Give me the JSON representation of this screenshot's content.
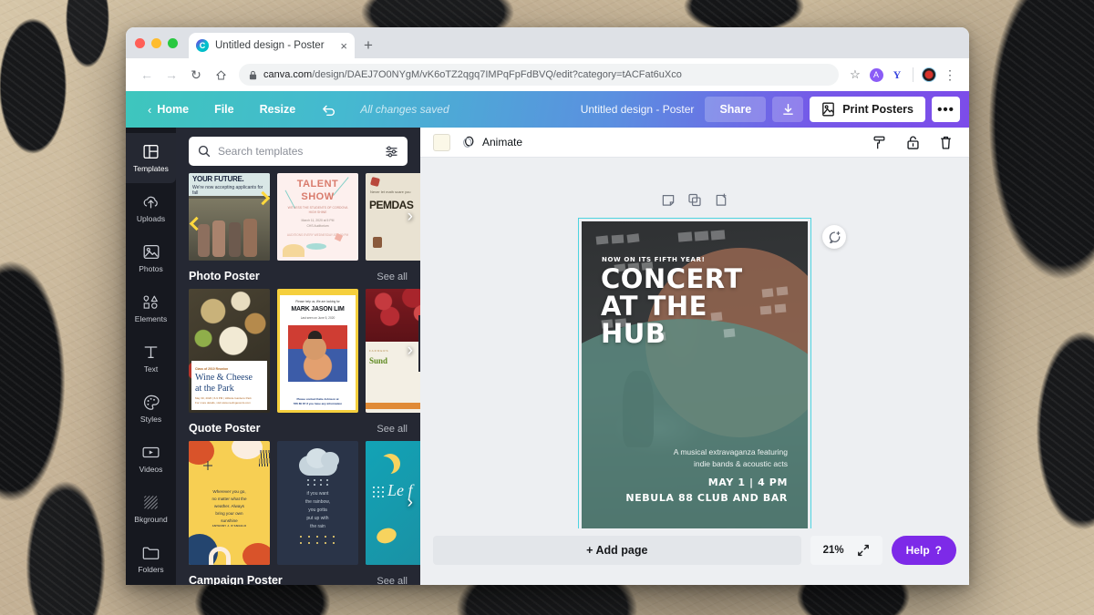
{
  "browser": {
    "tab": {
      "title": "Untitled design - Poster",
      "favicon": "canva-icon",
      "close": "×"
    },
    "new_tab": "+",
    "nav": {
      "back": "←",
      "forward": "→",
      "reload": "↻",
      "home": "⌂"
    },
    "url": {
      "lock": "🔒",
      "domain": "canva.com",
      "path": "/design/DAEJ7O0NYgM/vK6oTZ2qgq7IMPqFpFdBVQ/edit?category=tACFat6uXco"
    },
    "actions": {
      "bookmark": "☆",
      "ext_purple": "◉",
      "ext_y": "Y",
      "avatar": "avatar",
      "menu": "⋮"
    }
  },
  "canva_top": {
    "home": "Home",
    "file": "File",
    "resize": "Resize",
    "undo": "undo-icon",
    "saved_status": "All changes saved",
    "doc_name": "Untitled design - Poster",
    "share": "Share",
    "download": "download-icon",
    "print": "Print Posters",
    "more": "•••"
  },
  "rail": {
    "items": [
      {
        "label": "Templates",
        "icon": "templates-icon",
        "active": true
      },
      {
        "label": "Uploads",
        "icon": "upload-cloud-icon",
        "active": false
      },
      {
        "label": "Photos",
        "icon": "photo-icon",
        "active": false
      },
      {
        "label": "Elements",
        "icon": "shapes-icon",
        "active": false
      },
      {
        "label": "Text",
        "icon": "text-icon",
        "active": false
      },
      {
        "label": "Styles",
        "icon": "palette-icon",
        "active": false
      },
      {
        "label": "Videos",
        "icon": "video-icon",
        "active": false
      },
      {
        "label": "Bkground",
        "icon": "background-icon",
        "active": false
      },
      {
        "label": "Folders",
        "icon": "folder-icon",
        "active": false
      }
    ]
  },
  "panel": {
    "search_placeholder": "Search templates",
    "filter_icon": "filters-icon",
    "collapse_icon": "‹",
    "top_row": [
      {
        "name": "your-future-template",
        "line1": "YOUR FUTURE.",
        "line2": "We're now accepting applicants for fall"
      },
      {
        "name": "talent-show-template",
        "line1": "TALENT",
        "line2": "SHOW",
        "line3": "WITNESS THE STUDENTS OF CORDOVA HIGH SHINE",
        "line4": "March 11, 2020 at 5 PM\nCHS Auditorium",
        "line5": "AUDITIONS EVERY WEDNESDAY AT 4:00 PM"
      },
      {
        "name": "pemdas-template",
        "line1": "PEMDAS"
      }
    ],
    "sections": [
      {
        "title": "Photo Poster",
        "see_all": "See all",
        "items": [
          {
            "name": "wine-cheese-template",
            "eyebrow": "Class of 2010 Reunion",
            "title": "Wine & Cheese\nat the Park",
            "footer": "May 30, 2020 | 6-9 PM | Hillside Gardens Park\nFor more details, visit www.reelingevents.com"
          },
          {
            "name": "mark-jason-lim-template",
            "eyebrow": "Please help us, We are looking for",
            "title": "MARK JASON LIM",
            "sub": "Last seen on June 5, 2020",
            "footer": "Please contact Katie Johnson at\n555 80 87 if you have any information"
          },
          {
            "name": "sunday-market-template",
            "title": "Sund"
          }
        ]
      },
      {
        "title": "Quote Poster",
        "see_all": "See all",
        "items": [
          {
            "name": "sunshine-quote-template",
            "quote": "Wherever you go,\nno matter what the\nweather. Always\nbring your own\nsunshine",
            "attribution": "ANTHONY J. D'ANGELO"
          },
          {
            "name": "rainbow-quote-template",
            "quote": "if you want\nthe rainbow,\nyou gotta\nput up with\nthe rain"
          },
          {
            "name": "lemon-quote-template",
            "quote": "Le\nf"
          }
        ]
      },
      {
        "title": "Campaign Poster",
        "see_all": "See all",
        "items": []
      }
    ]
  },
  "editor": {
    "toolbar": {
      "color_swatch": "#fbf8e8",
      "animate": "Animate",
      "copy_style": "copy-style-icon",
      "lock": "lock-icon",
      "delete": "trash-icon"
    },
    "page_tools": {
      "notes": "notes-icon",
      "duplicate": "duplicate-icon",
      "add": "add-page-icon"
    },
    "comment": "comment-icon",
    "poster": {
      "kicker": "NOW ON ITS FIFTH YEAR!",
      "title_lines": [
        "CONCERT",
        "AT THE",
        "HUB"
      ],
      "subtitle_line1": "A musical extravaganza featuring",
      "subtitle_line2": "indie bands & acoustic acts",
      "date": "MAY 1 | 4 PM",
      "venue": "NEBULA 88 CLUB AND BAR",
      "selection_color": "#4dd3e0",
      "accent_teal": "#5d8c83",
      "accent_rust": "#9e6a52"
    },
    "bottom": {
      "add_page": "+ Add page",
      "zoom": "21%",
      "fullscreen": "expand-icon",
      "help": "Help",
      "help_mark": "?"
    }
  }
}
